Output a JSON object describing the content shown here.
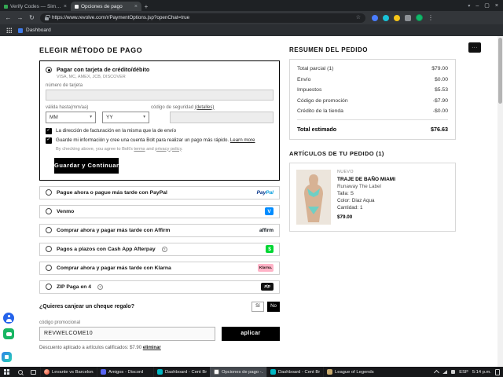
{
  "browser": {
    "tabs": [
      {
        "title": "Verify Codes — SimplyCodes"
      },
      {
        "title": "Opciones de pago"
      }
    ],
    "url": "https://www.revolve.com/r/PaymentOptions.jsp?openChat=true",
    "bookmarks_label": "Dashboard"
  },
  "brand_colors": {
    "venmo": "#008CFF",
    "cashapp": "#00D632",
    "klarna": "#FFB3C7",
    "paypal_dark": "#003087",
    "paypal_light": "#009cde",
    "accent_black": "#000000"
  },
  "checkout": {
    "heading": "ELEGIR MÉTODO DE PAGO",
    "card": {
      "title": "Pagar con tarjeta de crédito/débito",
      "subtitle": "VISA, MC, AMEX, JCB, DISCOVER",
      "number_label": "número de tarjeta",
      "expiry_label": "válida hasta(mm/aa)",
      "month": "MM",
      "year": "YY",
      "cvv_label": "código de seguridad ",
      "cvv_details_link": "(detalles)",
      "billing_checkbox": "La dirección de facturación en la misma que la de envío",
      "bolt_checkbox": "Guarde mi información y cree una cuenta Bolt para realizar un pago más rápido. ",
      "learn_more_link": "Learn more",
      "agree_prefix": "By checking above, you agree to Bolt's ",
      "terms_link": "terms",
      "agree_mid": " and ",
      "privacy_link": "privacy policy",
      "agree_suffix": ".",
      "submit_label": "Guardar y Continuar"
    },
    "options": [
      {
        "label": "Pague ahora o pague más tarde con PayPal",
        "logo_part1": "Pay",
        "logo_part2": "Pal"
      },
      {
        "label": "Venmo",
        "logo_text": "V"
      },
      {
        "label": "Comprar ahora y pagar más tarde con Affirm",
        "logo_text": "affirm"
      },
      {
        "label": "Pagos a plazos con Cash App Afterpay",
        "logo_text": "$"
      },
      {
        "label": "Comprar ahora y pagar más tarde con Klarna",
        "logo_text": "Klarna."
      },
      {
        "label": "ZIP Paga en 4",
        "logo_text": "zip"
      }
    ],
    "gift_question": "¿Quieres canjear un cheque regalo?",
    "gift_yes": "Sí",
    "gift_no": "No",
    "promo": {
      "label": "código promocional",
      "value": "REVWELCOME10",
      "apply_label": "aplicar",
      "note": "Descuento aplicado a artículos calificados: $7.90 ",
      "remove_link": "eliminar"
    }
  },
  "summary": {
    "heading": "RESUMEN DEL PEDIDO",
    "rows": [
      {
        "label": "Total parcial (1)",
        "value": "$79.00"
      },
      {
        "label": "Envío",
        "value": "$0.00"
      },
      {
        "label": "Impuestos",
        "value": "$5.53"
      },
      {
        "label": "Código de promoción",
        "value": "-$7.90"
      },
      {
        "label": "Crédito de la tienda",
        "value": "-$0.00"
      }
    ],
    "total_label": "Total estimado",
    "total_value": "$76.63"
  },
  "order_items": {
    "heading": "ARTÍCULOS DE TU PEDIDO (1)",
    "product": {
      "badge": "NUEVO",
      "name": "TRAJE DE BAÑO MIAMI",
      "brand": "Runaway The Label",
      "size_label": "Talla:",
      "size_value": "S",
      "color_label": "Color:",
      "color_value": "Diaz Aqua",
      "qty_label": "Cantidad:",
      "qty_value": "1",
      "price": "$79.00"
    }
  },
  "taskbar": {
    "apps": [
      {
        "label": "Levante vs Barcelona..."
      },
      {
        "label": "Amigos - Discord"
      },
      {
        "label": "Dashboard - Cent Br..."
      },
      {
        "label": "Opciones de pago -..."
      },
      {
        "label": "Dashboard - Cent Br..."
      },
      {
        "label": "League of Legends"
      }
    ],
    "tray": {
      "lang": "ESP",
      "time": "5:14 p.m."
    }
  }
}
